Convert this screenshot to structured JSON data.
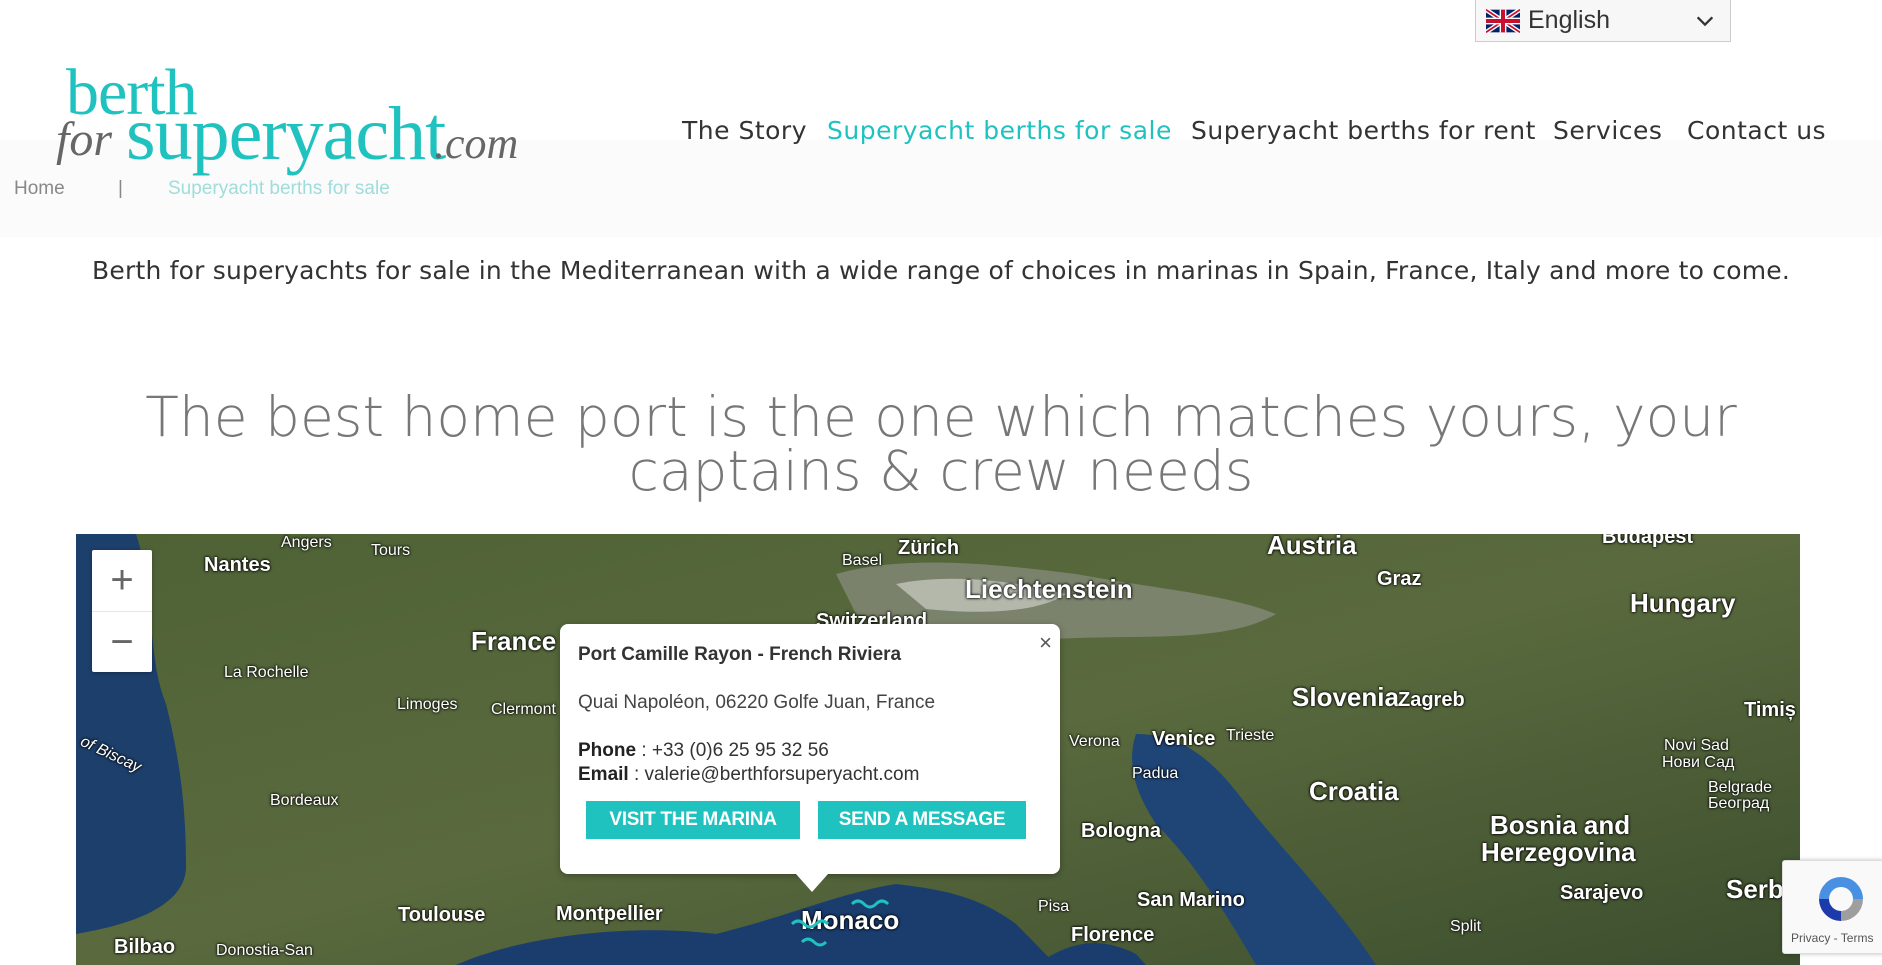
{
  "language": {
    "selected": "English",
    "flag_icon": "uk-flag-icon"
  },
  "brand": {
    "logo_parts": {
      "berth": "berth",
      "for": "for",
      "superyacht": "superyacht",
      "com": ".com"
    },
    "accent_color": "#20c2bf"
  },
  "nav": {
    "items": [
      {
        "label": "The Story",
        "active": false
      },
      {
        "label": "Superyacht berths for sale",
        "active": true
      },
      {
        "label": "Superyacht berths for rent",
        "active": false
      },
      {
        "label": "Services",
        "active": false
      },
      {
        "label": "Contact us",
        "active": false
      }
    ]
  },
  "breadcrumb": {
    "home": "Home",
    "separator": "|",
    "current": "Superyacht berths for sale"
  },
  "intro_text": "Berth for superyachts for sale in the Mediterranean with a wide range of choices in marinas in Spain, France, Italy and more to come.",
  "headline": "The best home port is the one which matches yours, your captains & crew needs",
  "map": {
    "zoom_in": "+",
    "zoom_out": "−",
    "labels": {
      "angers": "Angers",
      "tours": "Tours",
      "nantes": "Nantes",
      "la_rochelle": "La Rochelle",
      "france": "France",
      "limoges": "Limoges",
      "clermont": "Clermont",
      "biscay": "of Biscay",
      "bordeaux": "Bordeaux",
      "toulouse": "Toulouse",
      "montpellier": "Montpellier",
      "bilbao": "Bilbao",
      "donostia": "Donostia-San",
      "basel": "Basel",
      "zurich": "Zürich",
      "switzerland": "Switzerland",
      "liechtenstein": "Liechtenstein",
      "austria": "Austria",
      "graz": "Graz",
      "budapest": "Budapest",
      "hungary": "Hungary",
      "slovenia": "Slovenia",
      "zagreb": "Zagreb",
      "timis": "Timiș",
      "verona": "Verona",
      "venice": "Venice",
      "trieste": "Trieste",
      "padua": "Padua",
      "croatia": "Croatia",
      "novi_sad": "Novi Sad",
      "novi_sad_cyr": "Нови Сад",
      "belgrade": "Belgrade",
      "belgrade_cyr": "Београд",
      "bologna": "Bologna",
      "bosnia": "Bosnia and",
      "herzegovina": "Herzegovina",
      "sarajevo": "Sarajevo",
      "serb": "Serb",
      "san_marino": "San Marino",
      "pisa": "Pisa",
      "florence": "Florence",
      "monaco": "Monaco",
      "split": "Split"
    },
    "popup": {
      "title": "Port Camille Rayon - French Riviera",
      "address": "Quai Napoléon, 06220 Golfe Juan, France",
      "phone_label": "Phone",
      "phone_value": " : +33 (0)6 25 95 32 56",
      "email_label": "Email",
      "email_value": " : valerie@berthforsuperyacht.com",
      "visit_button": "VISIT THE MARINA",
      "message_button": "SEND A MESSAGE",
      "close": "×"
    }
  },
  "recaptcha": {
    "text": "Privacy - Terms"
  }
}
